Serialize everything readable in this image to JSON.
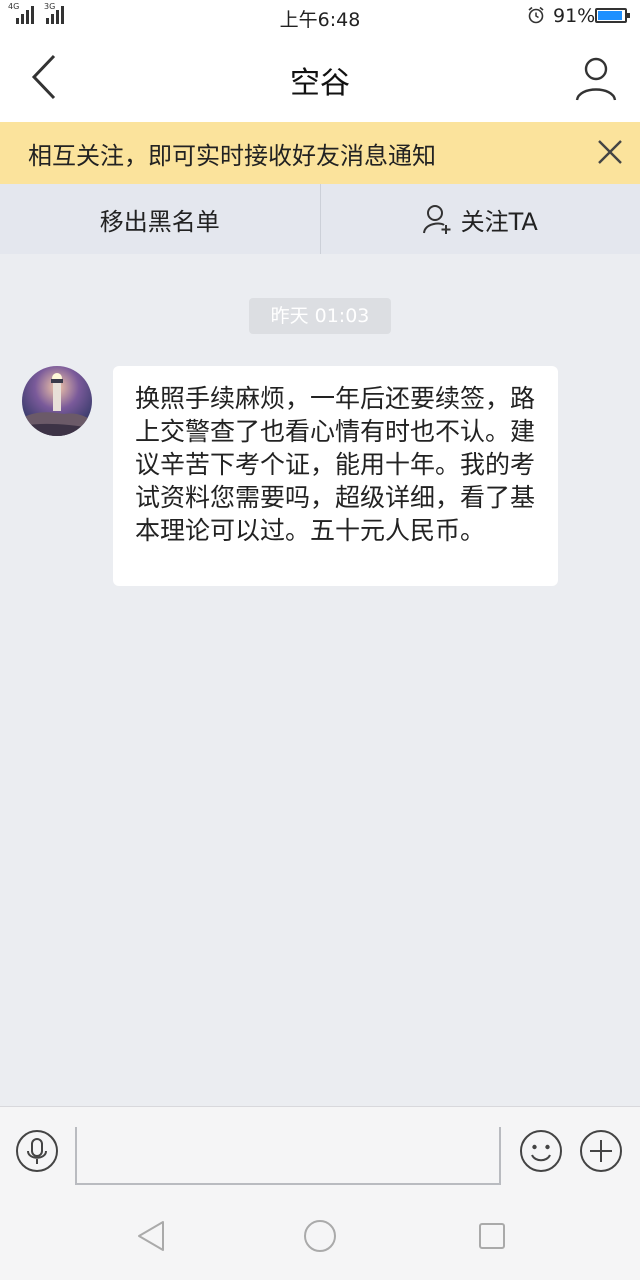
{
  "status_bar": {
    "network_1": "4G",
    "network_2": "3G",
    "time": "上午6:48",
    "battery_percent_text": "91%",
    "battery_level": 0.91
  },
  "nav": {
    "title": "空谷",
    "back_icon": "chevron-left-icon",
    "profile_icon": "user-icon"
  },
  "notice": {
    "text": "相互关注，即可实时接收好友消息通知",
    "close_icon": "close-icon"
  },
  "actions": {
    "remove_blacklist": "移出黑名单",
    "follow": "关注TA",
    "follow_icon": "user-plus-icon"
  },
  "messages": [
    {
      "timestamp": "昨天 01:03",
      "text": "换照手续麻烦，一年后还要续签，路上交警查了也看心情有时也不认。建议辛苦下考个证，能用十年。我的考试资料您需要吗，超级详细，看了基本理论可以过。五十元人民币。"
    }
  ],
  "input_bar": {
    "voice_icon": "microphone-icon",
    "emoji_icon": "smiley-icon",
    "plus_icon": "plus-circle-icon",
    "text_value": ""
  },
  "colors": {
    "notice_bg": "#fbe39c",
    "page_bg": "#ebedf1",
    "battery_fill": "#1e90ff"
  }
}
